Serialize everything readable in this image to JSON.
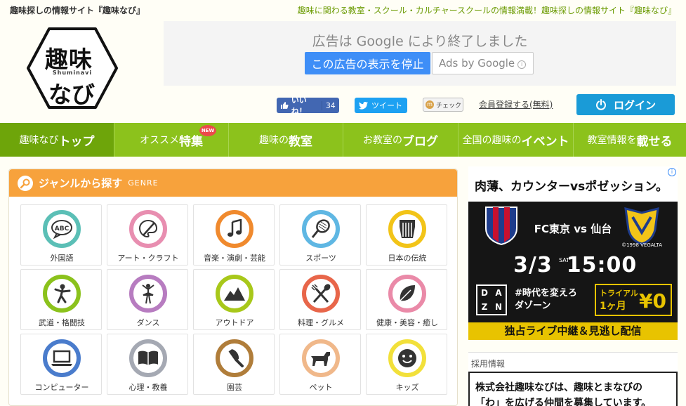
{
  "header": {
    "site_tag": "趣味探しの情報サイト『趣味なび』",
    "site_description": "趣味に関わる教室・スクール・カルチャースクールの情報満載！趣味探しの情報サイト『趣味なび』",
    "logo": {
      "line1": "趣味",
      "romaji": "Shuminavi",
      "line2": "なび"
    }
  },
  "top_ad": {
    "closed_text": "広告は Google により終了しました",
    "stop_button": "この広告の表示を停止",
    "ads_by": "Ads by Google",
    "info_glyph": "i"
  },
  "social": {
    "like_label": "いいね！",
    "like_count": "34",
    "tweet_label": "ツイート",
    "check_label": "チェック",
    "check_glyph": "m"
  },
  "account": {
    "register": "会員登録する(無料)",
    "login": "ログイン"
  },
  "nav": {
    "items": [
      {
        "pre": "趣味なび",
        "main": "トップ",
        "post": ""
      },
      {
        "pre": "オススメ",
        "main": "特集",
        "post": "",
        "badge": "NEW"
      },
      {
        "pre": "趣味の",
        "main": "教室",
        "post": ""
      },
      {
        "pre": "お教室の",
        "main": "ブログ",
        "post": ""
      },
      {
        "pre": "全国の趣味の",
        "main": "イベント",
        "post": ""
      },
      {
        "pre": "教室情報を",
        "main": "載せる",
        "post": ""
      }
    ]
  },
  "genre": {
    "title": "ジャンルから探す",
    "subtitle": "GENRE",
    "items": [
      {
        "label": "外国語",
        "icon": "abc-speech-icon",
        "color": "#5bbfb6"
      },
      {
        "label": "アート・クラフト",
        "icon": "palette-icon",
        "color": "#e88eb0"
      },
      {
        "label": "音楽・演劇・芸能",
        "icon": "music-note-icon",
        "color": "#f08a2e"
      },
      {
        "label": "スポーツ",
        "icon": "tennis-racket-icon",
        "color": "#5fb7e3"
      },
      {
        "label": "日本の伝統",
        "icon": "hakama-icon",
        "color": "#f2c418"
      },
      {
        "label": "武道・格闘技",
        "icon": "martial-arts-icon",
        "color": "#8bc21c"
      },
      {
        "label": "ダンス",
        "icon": "ballerina-icon",
        "color": "#b77cc0"
      },
      {
        "label": "アウトドア",
        "icon": "mountain-icon",
        "color": "#a8c81a"
      },
      {
        "label": "料理・グルメ",
        "icon": "utensils-icon",
        "color": "#e8664a"
      },
      {
        "label": "健康・美容・癒し",
        "icon": "leaf-icon",
        "color": "#ea8aa8"
      },
      {
        "label": "コンピューター",
        "icon": "laptop-icon",
        "color": "#4a7ccc"
      },
      {
        "label": "心理・教養",
        "icon": "book-icon",
        "color": "#a5a9b3"
      },
      {
        "label": "園芸",
        "icon": "trowel-icon",
        "color": "#b07d3a"
      },
      {
        "label": "ペット",
        "icon": "dog-icon",
        "color": "#f0b88a"
      },
      {
        "label": "キッズ",
        "icon": "smiley-icon",
        "color": "#f2e03a"
      }
    ]
  },
  "ad_right": {
    "headline": "肉薄、カウンターvsポゼッション。",
    "match": "FC東京 vs 仙台",
    "copyright": "©1998 VEGALTA",
    "date": "3/3",
    "dow": "SAT",
    "time": "15:00",
    "dazn_letters": [
      "D",
      "A",
      "Z",
      "N"
    ],
    "slogan1": "#時代を変えろ",
    "slogan2": "ダゾーン",
    "trial1": "トライアル",
    "trial2": "1ヶ月",
    "price": "¥0",
    "footer": "独占ライブ中継＆見逃し配信",
    "info_glyph": "i",
    "colors": {
      "tokyo": "#1e3c8c",
      "sendai": "#f2c418",
      "accent": "#e8c300"
    }
  },
  "recruit": {
    "caption": "採用情報",
    "line1": "株式会社趣味なびは、趣味とまなびの",
    "line2": "「わ」を広げる仲間を募集しています。"
  }
}
